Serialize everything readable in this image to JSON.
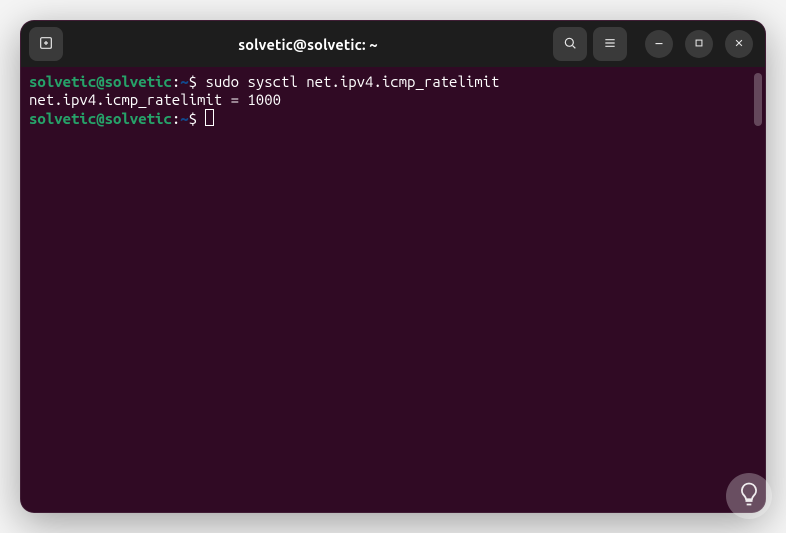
{
  "titlebar": {
    "title": "solvetic@solvetic: ~",
    "icons": {
      "new_tab": "new-tab-icon",
      "search": "search-icon",
      "menu": "hamburger-icon",
      "minimize": "minimize-icon",
      "maximize": "maximize-icon",
      "close": "close-icon"
    }
  },
  "terminal": {
    "lines": [
      {
        "prompt_user": "solvetic@solvetic",
        "prompt_sep": ":",
        "prompt_path": "~",
        "prompt_sym": "$ ",
        "command": "sudo sysctl net.ipv4.icmp_ratelimit"
      },
      {
        "output": "net.ipv4.icmp_ratelimit = 1000"
      },
      {
        "prompt_user": "solvetic@solvetic",
        "prompt_sep": ":",
        "prompt_path": "~",
        "prompt_sym": "$ ",
        "command": ""
      }
    ]
  }
}
